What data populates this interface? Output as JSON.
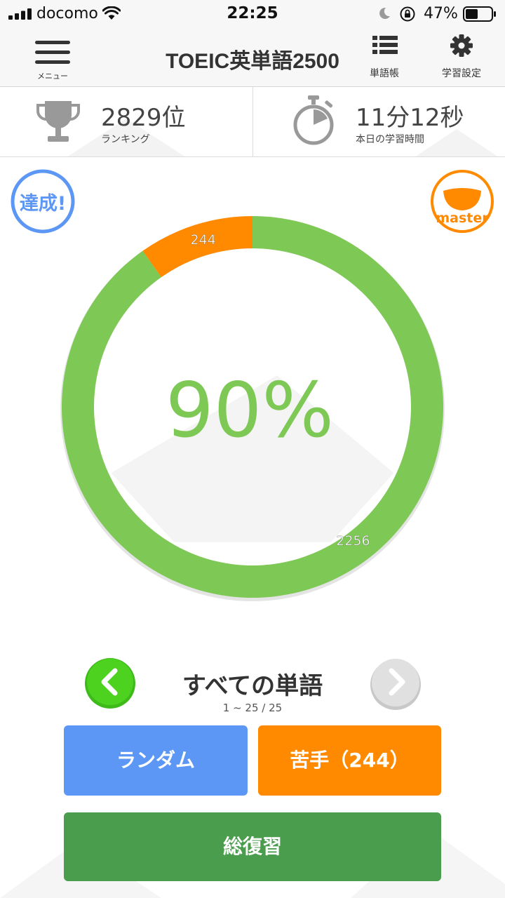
{
  "status_bar": {
    "carrier": "docomo",
    "time": "22:25",
    "battery_percent": "47%",
    "icons": [
      "signal-icon",
      "wifi-icon",
      "moon-icon",
      "rotation-lock-icon",
      "battery-icon"
    ]
  },
  "nav": {
    "menu_label": "メニュー",
    "title": "TOEIC英単語2500",
    "wordbook_label": "単語帳",
    "settings_label": "学習設定"
  },
  "stats": {
    "ranking_value": "2829位",
    "ranking_label": "ランキング",
    "study_time_value": "11分12秒",
    "study_time_label": "本日の学習時間"
  },
  "badges": {
    "achieved": "達成!",
    "master": "master"
  },
  "chart_data": {
    "type": "pie",
    "variant": "donut",
    "center_label": "90%",
    "segments": [
      {
        "label": "2256",
        "value": 2256,
        "color": "#7ec855"
      },
      {
        "label": "244",
        "value": 244,
        "color": "#ff8a00"
      }
    ]
  },
  "category": {
    "title": "すべての単語",
    "range": "1 ~ 25 / 25"
  },
  "buttons": {
    "random": "ランダム",
    "weak": "苦手（244）",
    "review": "総復習"
  },
  "colors": {
    "accent_green": "#7ec855",
    "accent_orange": "#ff8a00",
    "accent_blue": "#5c97f5",
    "review_green": "#4b9d4e"
  }
}
